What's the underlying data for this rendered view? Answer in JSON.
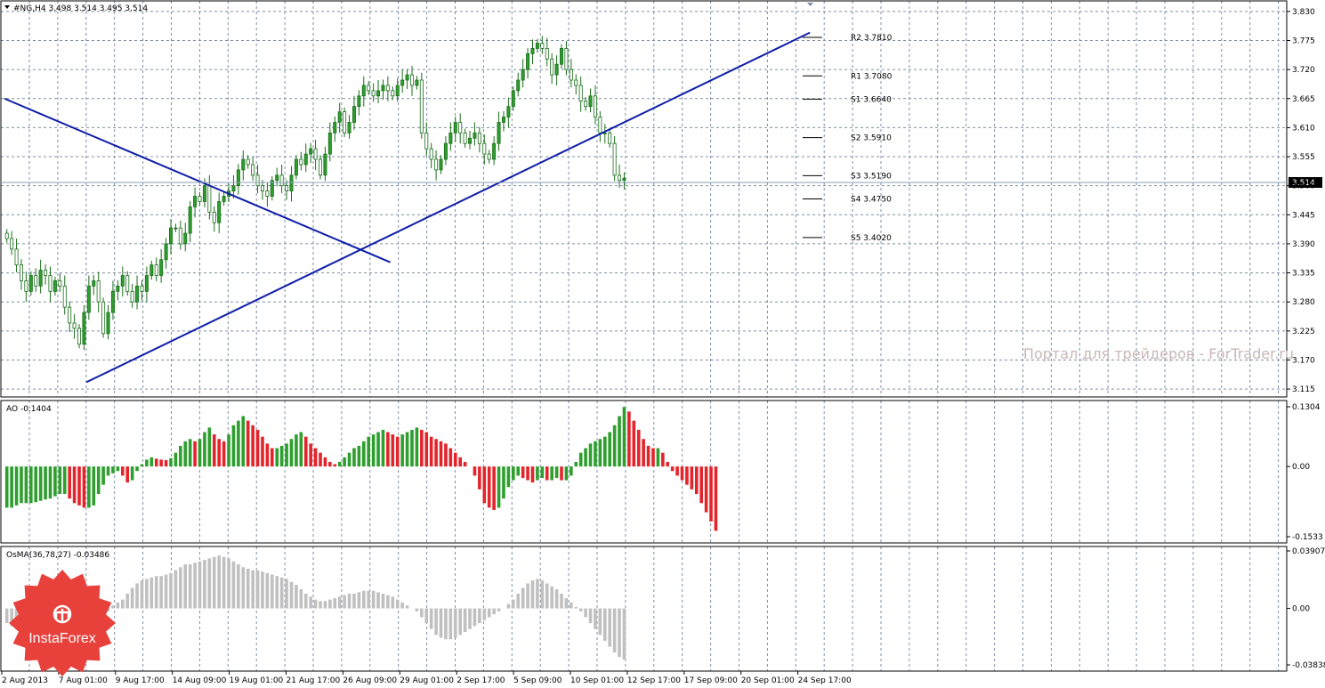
{
  "header": {
    "symbol_ohlc": "#NG,H4  3.498 3.514 3.495 3.514"
  },
  "watermark": "Портал для трейдеров - ForTrader.ru",
  "logo": {
    "text": "InstaForex",
    "color": "#e8413c"
  },
  "colors": {
    "bull": "#2e9e2e",
    "bear": "#e3242b",
    "line": "#0f1fa8",
    "osma": "#c0c0c0",
    "grid": "#7f8fa6",
    "price_line": "#8aa0b8"
  },
  "chart_data": {
    "type": "candlestick",
    "current_price": "3.514",
    "price_ticks": [
      "3.830",
      "3.775",
      "3.720",
      "3.665",
      "3.610",
      "3.555",
      "3.500",
      "3.445",
      "3.390",
      "3.335",
      "3.280",
      "3.225",
      "3.170",
      "3.115"
    ],
    "price_range": [
      3.1,
      3.85
    ],
    "time_labels": [
      "2 Aug 2013",
      "7 Aug 01:00",
      "9 Aug 17:00",
      "14 Aug 09:00",
      "19 Aug 01:00",
      "21 Aug 17:00",
      "26 Aug 09:00",
      "29 Aug 01:00",
      "2 Sep 17:00",
      "5 Sep 09:00",
      "10 Sep 01:00",
      "12 Sep 17:00",
      "17 Sep 09:00",
      "20 Sep 01:00",
      "24 Sep 17:00"
    ],
    "pivot_levels": [
      {
        "label": "R2 3.7810",
        "value": 3.781
      },
      {
        "label": "R1 3.7080",
        "value": 3.708
      },
      {
        "label": "S1 3.6640",
        "value": 3.664
      },
      {
        "label": "S2 3.5910",
        "value": 3.591
      },
      {
        "label": "S3 3.5190",
        "value": 3.519
      },
      {
        "label": "S4 3.4750",
        "value": 3.475
      },
      {
        "label": "S5 3.4020",
        "value": 3.402
      }
    ],
    "closes": [
      3.4,
      3.38,
      3.35,
      3.32,
      3.3,
      3.33,
      3.31,
      3.34,
      3.33,
      3.3,
      3.32,
      3.31,
      3.27,
      3.24,
      3.23,
      3.2,
      3.26,
      3.31,
      3.32,
      3.28,
      3.22,
      3.26,
      3.3,
      3.31,
      3.33,
      3.3,
      3.28,
      3.31,
      3.3,
      3.33,
      3.35,
      3.33,
      3.36,
      3.39,
      3.42,
      3.42,
      3.39,
      3.41,
      3.46,
      3.48,
      3.47,
      3.5,
      3.45,
      3.43,
      3.47,
      3.48,
      3.49,
      3.5,
      3.53,
      3.55,
      3.54,
      3.52,
      3.5,
      3.49,
      3.48,
      3.51,
      3.52,
      3.5,
      3.49,
      3.52,
      3.55,
      3.54,
      3.56,
      3.57,
      3.55,
      3.52,
      3.56,
      3.6,
      3.62,
      3.64,
      3.6,
      3.62,
      3.65,
      3.67,
      3.69,
      3.68,
      3.67,
      3.68,
      3.69,
      3.68,
      3.67,
      3.69,
      3.7,
      3.71,
      3.69,
      3.7,
      3.6,
      3.57,
      3.55,
      3.53,
      3.55,
      3.58,
      3.6,
      3.62,
      3.6,
      3.58,
      3.59,
      3.6,
      3.58,
      3.56,
      3.55,
      3.58,
      3.62,
      3.63,
      3.65,
      3.68,
      3.7,
      3.72,
      3.75,
      3.76,
      3.77,
      3.76,
      3.74,
      3.71,
      3.73,
      3.76,
      3.72,
      3.7,
      3.69,
      3.66,
      3.65,
      3.67,
      3.63,
      3.6,
      3.6,
      3.58,
      3.52,
      3.51,
      3.514
    ],
    "trendlines": [
      {
        "from": {
          "bar": 0,
          "price": 3.665
        },
        "to": {
          "bar": 80,
          "price": 3.355
        }
      },
      {
        "from": {
          "bar": 17,
          "price": 3.128
        },
        "to": {
          "bar": 167,
          "price": 3.79
        }
      }
    ],
    "ao": {
      "label": "AO -0.1404",
      "ticks": [
        "0.1304",
        "0.00",
        "-0.1533"
      ],
      "range": [
        -0.1533,
        0.1304
      ],
      "values": [
        -0.09,
        -0.09,
        -0.085,
        -0.08,
        -0.08,
        -0.08,
        -0.078,
        -0.075,
        -0.072,
        -0.07,
        -0.065,
        -0.06,
        -0.06,
        -0.07,
        -0.08,
        -0.085,
        -0.09,
        -0.09,
        -0.085,
        -0.06,
        -0.04,
        -0.02,
        -0.015,
        -0.01,
        -0.02,
        -0.035,
        -0.03,
        -0.01,
        0.005,
        0.015,
        0.02,
        0.017,
        0.015,
        0.014,
        0.018,
        0.03,
        0.045,
        0.055,
        0.06,
        0.055,
        0.06,
        0.075,
        0.085,
        0.07,
        0.06,
        0.055,
        0.07,
        0.09,
        0.1,
        0.11,
        0.1,
        0.09,
        0.08,
        0.065,
        0.05,
        0.04,
        0.04,
        0.045,
        0.05,
        0.06,
        0.07,
        0.075,
        0.065,
        0.05,
        0.04,
        0.03,
        0.02,
        0.01,
        0.005,
        0.01,
        0.02,
        0.03,
        0.04,
        0.045,
        0.055,
        0.065,
        0.07,
        0.075,
        0.08,
        0.075,
        0.07,
        0.065,
        0.07,
        0.075,
        0.08,
        0.085,
        0.08,
        0.075,
        0.065,
        0.06,
        0.055,
        0.05,
        0.04,
        0.03,
        0.02,
        0.01,
        0.0,
        -0.02,
        -0.05,
        -0.08,
        -0.09,
        -0.095,
        -0.09,
        -0.07,
        -0.045,
        -0.03,
        -0.02,
        -0.025,
        -0.03,
        -0.035,
        -0.03,
        -0.025,
        -0.03,
        -0.03,
        -0.025,
        -0.03,
        -0.03,
        -0.02,
        0.01,
        0.03,
        0.04,
        0.05,
        0.055,
        0.06,
        0.065,
        0.075,
        0.09,
        0.11,
        0.13,
        0.12,
        0.1,
        0.08,
        0.06,
        0.045,
        0.04,
        0.04,
        0.03,
        0.01,
        -0.01,
        -0.02,
        -0.03,
        -0.04,
        -0.05,
        -0.06,
        -0.08,
        -0.1,
        -0.12,
        -0.1404
      ]
    },
    "osma": {
      "label": "OsMA(36,78,27) -0.03486",
      "ticks": [
        "0.03907",
        "0.00",
        "-0.03838"
      ],
      "range": [
        -0.03838,
        0.03907
      ],
      "values": [
        -0.01,
        -0.012,
        -0.014,
        -0.016,
        -0.017,
        -0.018,
        -0.019,
        -0.02,
        -0.021,
        -0.022,
        -0.022,
        -0.02,
        -0.018,
        -0.017,
        -0.018,
        -0.02,
        -0.021,
        -0.02,
        -0.015,
        -0.01,
        -0.005,
        -0.002,
        0.002,
        0.004,
        0.006,
        0.01,
        0.014,
        0.017,
        0.019,
        0.02,
        0.021,
        0.022,
        0.022,
        0.023,
        0.024,
        0.026,
        0.028,
        0.03,
        0.03,
        0.031,
        0.032,
        0.033,
        0.034,
        0.035,
        0.036,
        0.035,
        0.034,
        0.032,
        0.03,
        0.028,
        0.027,
        0.026,
        0.026,
        0.025,
        0.024,
        0.023,
        0.022,
        0.021,
        0.02,
        0.018,
        0.016,
        0.013,
        0.01,
        0.008,
        0.006,
        0.005,
        0.005,
        0.006,
        0.007,
        0.008,
        0.009,
        0.01,
        0.01,
        0.011,
        0.012,
        0.012,
        0.012,
        0.011,
        0.01,
        0.009,
        0.008,
        0.006,
        0.004,
        0.002,
        0.0,
        -0.002,
        -0.006,
        -0.01,
        -0.014,
        -0.018,
        -0.02,
        -0.021,
        -0.021,
        -0.02,
        -0.018,
        -0.016,
        -0.014,
        -0.012,
        -0.01,
        -0.008,
        -0.006,
        -0.004,
        -0.002,
        0.0,
        0.003,
        0.006,
        0.01,
        0.014,
        0.017,
        0.019,
        0.02,
        0.019,
        0.017,
        0.015,
        0.013,
        0.01,
        0.007,
        0.004,
        0.001,
        -0.002,
        -0.006,
        -0.01,
        -0.014,
        -0.018,
        -0.022,
        -0.026,
        -0.03,
        -0.033,
        -0.03486
      ]
    }
  }
}
